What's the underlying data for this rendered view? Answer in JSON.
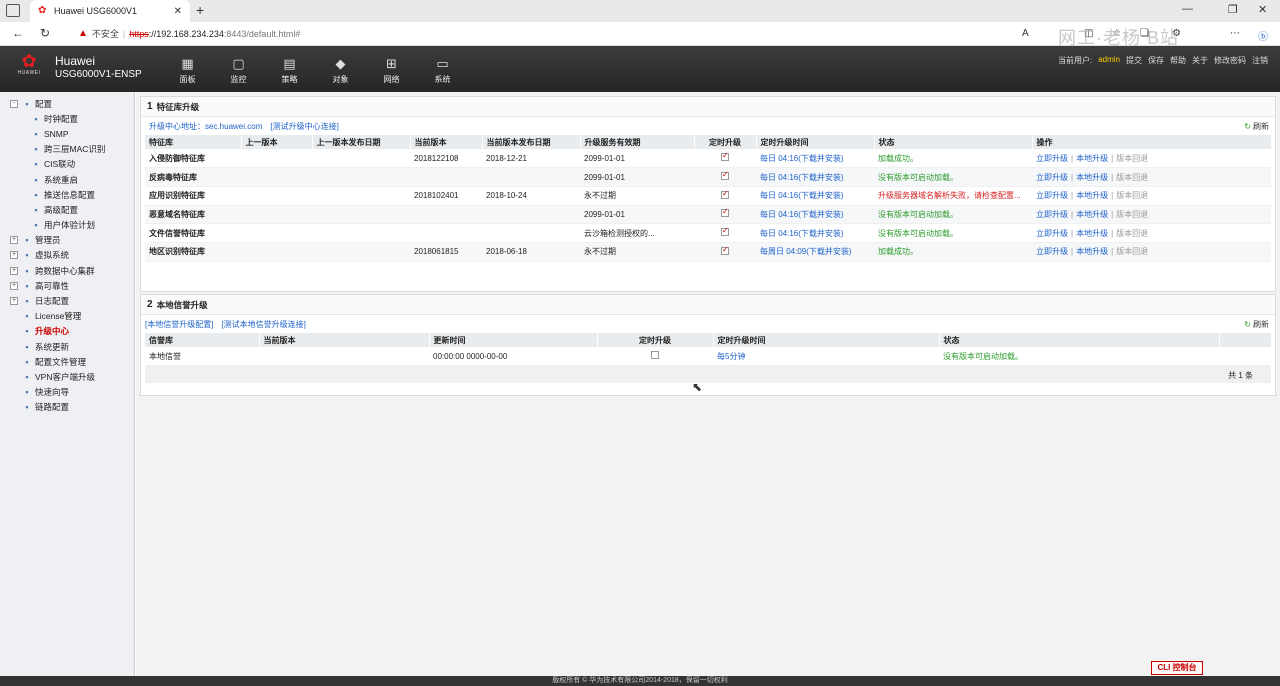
{
  "browser": {
    "tab_title": "Huawei USG6000V1",
    "insecure_label": "不安全",
    "url_https": "https",
    "url_host": "://192.168.234.234",
    "url_path": ":8443/default.html#",
    "overlay_text": "网工·老杨 B站"
  },
  "header": {
    "brand_short": "HUAWEI",
    "title1": "Huawei",
    "title2": "USG6000V1-ENSP",
    "nav": [
      {
        "label": "面板",
        "icon": "dashboard-icon"
      },
      {
        "label": "监控",
        "icon": "monitor-icon"
      },
      {
        "label": "策略",
        "icon": "policy-icon"
      },
      {
        "label": "对象",
        "icon": "object-icon"
      },
      {
        "label": "网络",
        "icon": "network-icon"
      },
      {
        "label": "系统",
        "icon": "system-icon"
      }
    ],
    "user_prefix": "当前用户:",
    "user": "admin",
    "actions": [
      "提交",
      "保存",
      "帮助",
      "关于",
      "修改密码",
      "注销"
    ]
  },
  "sidebar": {
    "items": [
      {
        "label": "配置",
        "level": 0,
        "pm": "-"
      },
      {
        "label": "时钟配置",
        "level": 1
      },
      {
        "label": "SNMP",
        "level": 1
      },
      {
        "label": "跨三层MAC识别",
        "level": 1
      },
      {
        "label": "CIS联动",
        "level": 1
      },
      {
        "label": "系统重启",
        "level": 1
      },
      {
        "label": "推送信息配置",
        "level": 1
      },
      {
        "label": "高级配置",
        "level": 1
      },
      {
        "label": "用户体验计划",
        "level": 1
      },
      {
        "label": "管理员",
        "level": 0,
        "pm": "+"
      },
      {
        "label": "虚拟系统",
        "level": 0,
        "pm": "+"
      },
      {
        "label": "跨数据中心集群",
        "level": 0,
        "pm": "+"
      },
      {
        "label": "高可靠性",
        "level": 0,
        "pm": "+"
      },
      {
        "label": "日志配置",
        "level": 0,
        "pm": "+"
      },
      {
        "label": "License管理",
        "level": 0
      },
      {
        "label": "升级中心",
        "level": 0,
        "active": true
      },
      {
        "label": "系统更新",
        "level": 0
      },
      {
        "label": "配置文件管理",
        "level": 0
      },
      {
        "label": "VPN客户端升级",
        "level": 0
      },
      {
        "label": "快速向导",
        "level": 0
      },
      {
        "label": "链路配置",
        "level": 0
      }
    ]
  },
  "section1": {
    "num": "1",
    "title": "特征库升级",
    "center_label": "升级中心地址：",
    "center_addr": "sec.huawei.com",
    "test_link": "[测试升级中心连接]",
    "refresh": "刷新",
    "columns": [
      "特征库",
      "上一版本",
      "上一版本发布日期",
      "当前版本",
      "当前版本发布日期",
      "升级服务有效期",
      "定时升级",
      "定时升级时间",
      "状态",
      "操作"
    ],
    "rows": [
      {
        "name": "入侵防御特征库",
        "prev": "",
        "prev_date": "",
        "cur": "2018122108",
        "cur_date": "2018-12-21",
        "valid": "2099-01-01",
        "sched_time": "每日 04:16(下载并安装)",
        "status": "加载成功。",
        "status_type": "ok"
      },
      {
        "name": "反病毒特征库",
        "prev": "",
        "prev_date": "",
        "cur": "",
        "cur_date": "",
        "valid": "2099-01-01",
        "sched_time": "每日 04:16(下载并安装)",
        "status": "没有版本可启动加载。",
        "status_type": "ok"
      },
      {
        "name": "应用识别特征库",
        "prev": "",
        "prev_date": "",
        "cur": "2018102401",
        "cur_date": "2018-10-24",
        "valid": "永不过期",
        "sched_time": "每日 04:16(下载并安装)",
        "status": "升级服务器域名解析失败，请检查配置...",
        "status_type": "err"
      },
      {
        "name": "恶意域名特征库",
        "prev": "",
        "prev_date": "",
        "cur": "",
        "cur_date": "",
        "valid": "2099-01-01",
        "sched_time": "每日 04:16(下载并安装)",
        "status": "没有版本可启动加载。",
        "status_type": "ok"
      },
      {
        "name": "文件信誉特征库",
        "prev": "",
        "prev_date": "",
        "cur": "",
        "cur_date": "",
        "valid": "云沙箱检测授权的...",
        "sched_time": "每日 04:16(下载并安装)",
        "status": "没有版本可启动加载。",
        "status_type": "ok"
      },
      {
        "name": "地区识别特征库",
        "prev": "",
        "prev_date": "",
        "cur": "2018061815",
        "cur_date": "2018-06-18",
        "valid": "永不过期",
        "sched_time": "每周日 04:09(下载并安装)",
        "status": "加载成功。",
        "status_type": "ok"
      }
    ],
    "ops": [
      "立即升级",
      "本地升级",
      "版本回退"
    ]
  },
  "section2": {
    "num": "2",
    "title": "本地信誉升级",
    "link1": "[本地信誉升级配置]",
    "link2": "[测试本地信誉升级连接]",
    "refresh": "刷新",
    "columns": [
      "信誉库",
      "当前版本",
      "更新时间",
      "定时升级",
      "定时升级时间",
      "状态"
    ],
    "rows": [
      {
        "name": "本地信誉",
        "cur": "",
        "update": "00:00:00 0000-00-00",
        "sched_time": "每5分钟",
        "status": "没有版本可启动加载。"
      }
    ],
    "total": "共 1 条"
  },
  "footer": {
    "cli": "CLI 控制台",
    "copyright": "版权所有 © 华为技术有限公司2014-2018，保留一切权利"
  }
}
